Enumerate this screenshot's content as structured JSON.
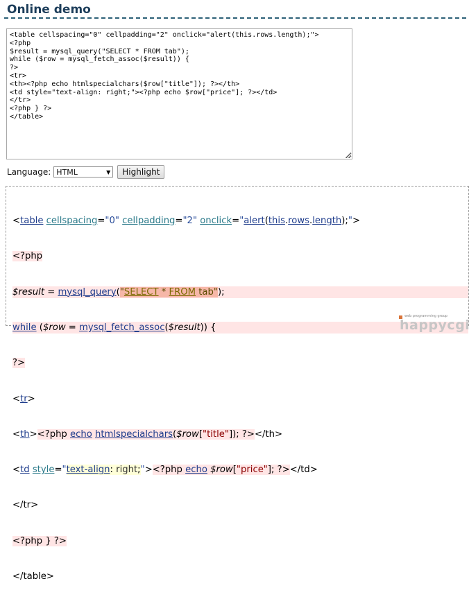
{
  "page": {
    "title": "Online demo"
  },
  "editor": {
    "lines": [
      "<table cellspacing=\"0\" cellpadding=\"2\" onclick=\"alert(this.rows.length);\">",
      "<?php",
      "$result = mysql_query(\"SELECT * FROM tab\");",
      "while ($row = mysql_fetch_assoc($result)) {",
      "?>",
      "<tr>",
      "<th><?php echo htmlspecialchars($row[\"title\"]); ?></th>",
      "<td style=\"text-align: right;\"><?php echo $row[\"price\"]; ?></td>",
      "</tr>",
      "<?php } ?>",
      "</table>"
    ]
  },
  "controls": {
    "language_label": "Language:",
    "language_value": "HTML",
    "highlight_button": "Highlight"
  },
  "output": {
    "l1": {
      "a": "<",
      "tag": "table",
      "b": " ",
      "a1": "cellspacing",
      "e1": "=",
      "v1": "\"0\"",
      "s1": " ",
      "a2": "cellpadding",
      "e2": "=",
      "v2": "\"2\"",
      "s2": " ",
      "a3": "onclick",
      "e3": "=",
      "q1": "\"",
      "f1": "alert",
      "p1": "(",
      "k1": "this",
      "d1": ".",
      "k2": "rows",
      "d2": ".",
      "k3": "length",
      "p2": ");",
      "q2": "\"",
      "c": ">"
    },
    "l2": {
      "t": "<?php"
    },
    "l3": {
      "v": "$result",
      "eq": " = ",
      "fn": "mysql_query",
      "po": "(",
      "q1": "\"",
      "s1": "SELECT",
      "m": " * ",
      "s2": "FROM",
      "n": " tab",
      "q2": "\"",
      "pc": ");"
    },
    "l4": {
      "kw": "while",
      "a": " (",
      "v1": "$row",
      "eq": " = ",
      "fn": "mysql_fetch_assoc",
      "po": "(",
      "v2": "$result",
      "pc": ")) {"
    },
    "l5": {
      "t": "?>"
    },
    "l6": {
      "a": "<",
      "tag": "tr",
      "c": ">"
    },
    "l7": {
      "a": "<",
      "tag": "th",
      "c": ">",
      "php": "<?php ",
      "kw": "echo",
      "sp": " ",
      "fn": "htmlspecialchars",
      "po": "(",
      "v": "$row",
      "br": "[",
      "str": "\"title\"",
      "bc": "]);",
      "end": " ?>",
      "close": "</th>"
    },
    "l8": {
      "a": "<",
      "tag": "td",
      "b": " ",
      "attr": "style",
      "eq": "=",
      "q1": "\"",
      "prop": "text-align",
      "colon": ": ",
      "val": "right",
      "semi": ";",
      "q2": "\"",
      "c": ">",
      "php": "<?php ",
      "kw": "echo",
      "sp": " ",
      "v": "$row",
      "br": "[",
      "str": "\"price\"",
      "bc": "];",
      "end": " ?>",
      "close": "</td>"
    },
    "l9": {
      "t": "</tr>"
    },
    "l10": {
      "t": "<?php } ?>"
    },
    "l11": {
      "t": "</table>"
    }
  },
  "logo": {
    "small": "web programming group",
    "big": "happycgi"
  }
}
